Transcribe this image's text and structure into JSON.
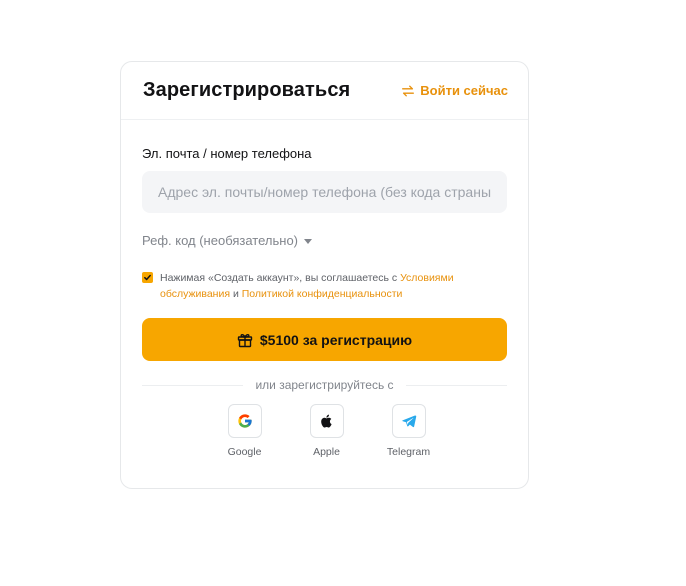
{
  "header": {
    "title": "Зарегистрироваться",
    "login_link": "Войти сейчас"
  },
  "form": {
    "email_label": "Эл. почта / номер телефона",
    "email_placeholder": "Адрес эл. почты/номер телефона (без кода страны)",
    "email_value": "",
    "referral_label": "Реф. код (необязательно)",
    "agree_checked": true,
    "agree_text_1": "Нажимая «Создать аккаунт», вы соглашаетесь с ",
    "agree_link_terms": "Условиями обслуживания",
    "agree_text_2": " и ",
    "agree_link_privacy": "Политикой конфиденциальности",
    "cta_label": "$5100 за регистрацию"
  },
  "social": {
    "divider_text": "или зарегистрируйтесь с",
    "items": [
      {
        "label": "Google",
        "icon": "google-icon"
      },
      {
        "label": "Apple",
        "icon": "apple-icon"
      },
      {
        "label": "Telegram",
        "icon": "telegram-icon"
      }
    ]
  },
  "colors": {
    "accent": "#f7a600",
    "link": "#e8910c",
    "input_bg": "#f4f5f7"
  }
}
